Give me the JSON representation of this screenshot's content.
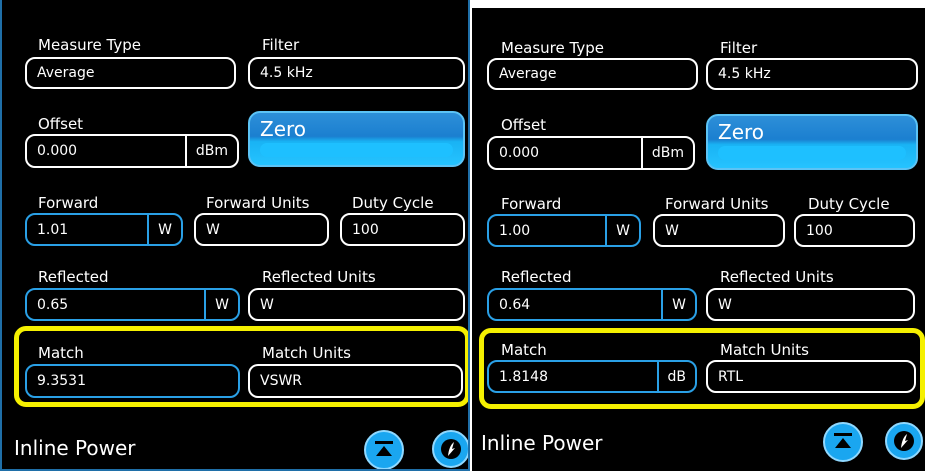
{
  "left": {
    "measure_type_label": "Measure Type",
    "measure_type_value": "Average",
    "filter_label": "Filter",
    "filter_value": "4.5 kHz",
    "offset_label": "Offset",
    "offset_value": "0.000",
    "offset_unit": "dBm",
    "zero_label": "Zero",
    "forward_label": "Forward",
    "forward_value": "1.01",
    "forward_unit": "W",
    "forward_units_label": "Forward Units",
    "forward_units_value": "W",
    "duty_cycle_label": "Duty Cycle",
    "duty_cycle_value": "100",
    "reflected_label": "Reflected",
    "reflected_value": "0.65",
    "reflected_unit": "W",
    "reflected_units_label": "Reflected Units",
    "reflected_units_value": "W",
    "match_label": "Match",
    "match_value": "9.3531",
    "match_units_label": "Match Units",
    "match_units_value": "VSWR",
    "footer_title": "Inline Power"
  },
  "right": {
    "measure_type_label": "Measure Type",
    "measure_type_value": "Average",
    "filter_label": "Filter",
    "filter_value": "4.5 kHz",
    "offset_label": "Offset",
    "offset_value": "0.000",
    "offset_unit": "dBm",
    "zero_label": "Zero",
    "forward_label": "Forward",
    "forward_value": "1.00",
    "forward_unit": "W",
    "forward_units_label": "Forward Units",
    "forward_units_value": "W",
    "duty_cycle_label": "Duty Cycle",
    "duty_cycle_value": "100",
    "reflected_label": "Reflected",
    "reflected_value": "0.64",
    "reflected_unit": "W",
    "reflected_units_label": "Reflected Units",
    "reflected_units_value": "W",
    "match_label": "Match",
    "match_value": "1.8148",
    "match_unit": "dB",
    "match_units_label": "Match Units",
    "match_units_value": "RTL",
    "footer_title": "Inline Power"
  },
  "colors": {
    "background": "#000000",
    "accent_blue": "#2aa0e6",
    "highlight_yellow": "#f5f000",
    "text": "#ffffff"
  },
  "icons": [
    "collapse-icon",
    "power-sensor-icon"
  ]
}
